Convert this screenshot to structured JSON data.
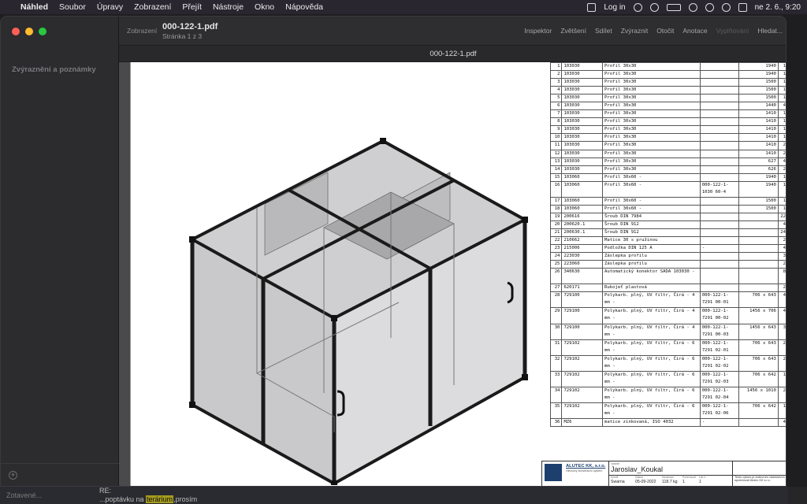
{
  "menubar": {
    "apple_glyph": "",
    "items": [
      "Náhled",
      "Soubor",
      "Úpravy",
      "Zobrazení",
      "Přejít",
      "Nástroje",
      "Okno",
      "Nápověda"
    ],
    "login": "Log in",
    "datetime": "ne 2. 6., 9:20"
  },
  "window": {
    "sidebar_title": "Zvýraznění a poznámky",
    "add_glyph": "+",
    "toolbar": {
      "view_label": "Zobrazení",
      "doc_name": "000-122-1.pdf",
      "page_info": "Stránka 1 z 3",
      "actions": [
        "Inspektor",
        "Zvětšení",
        "Sdílet",
        "Zvýraznit",
        "Otočit",
        "Anotace"
      ],
      "actions_disabled": [
        "Vyplňování"
      ],
      "search_label": "Hledat..."
    },
    "tab_title": "000-122-1.pdf"
  },
  "parts": [
    {
      "n": "1",
      "code": "103030",
      "desc": "Profil 30x30",
      "spec": "",
      "size": "1940",
      "qty": "1"
    },
    {
      "n": "2",
      "code": "103030",
      "desc": "Profil 30x30",
      "spec": "",
      "size": "1940",
      "qty": "1"
    },
    {
      "n": "3",
      "code": "103030",
      "desc": "Profil 30x30",
      "spec": "",
      "size": "1500",
      "qty": "1"
    },
    {
      "n": "4",
      "code": "103030",
      "desc": "Profil 30x30",
      "spec": "",
      "size": "1500",
      "qty": "1"
    },
    {
      "n": "5",
      "code": "103030",
      "desc": "Profil 30x30",
      "spec": "",
      "size": "1500",
      "qty": "1"
    },
    {
      "n": "6",
      "code": "103030",
      "desc": "Profil 30x30",
      "spec": "",
      "size": "1440",
      "qty": "4"
    },
    {
      "n": "7",
      "code": "103030",
      "desc": "Profil 30x30",
      "spec": "",
      "size": "1410",
      "qty": "1"
    },
    {
      "n": "8",
      "code": "103030",
      "desc": "Profil 30x30",
      "spec": "",
      "size": "1410",
      "qty": "1"
    },
    {
      "n": "9",
      "code": "103030",
      "desc": "Profil 30x30",
      "spec": "",
      "size": "1410",
      "qty": "1"
    },
    {
      "n": "10",
      "code": "103030",
      "desc": "Profil 30x30",
      "spec": "",
      "size": "1410",
      "qty": "1"
    },
    {
      "n": "11",
      "code": "103030",
      "desc": "Profil 30x30",
      "spec": "",
      "size": "1410",
      "qty": "2"
    },
    {
      "n": "12",
      "code": "103030",
      "desc": "Profil 30x30",
      "spec": "",
      "size": "1410",
      "qty": "2"
    },
    {
      "n": "13",
      "code": "103030",
      "desc": "Profil 30x30",
      "spec": "",
      "size": "627",
      "qty": "4"
    },
    {
      "n": "14",
      "code": "103030",
      "desc": "Profil 30x30",
      "spec": "",
      "size": "626",
      "qty": "2"
    },
    {
      "n": "15",
      "code": "103060",
      "desc": "Profil 30x60 -",
      "spec": "",
      "size": "1940",
      "qty": "1"
    },
    {
      "n": "16",
      "code": "103060",
      "desc": "Profil 30x60 -",
      "spec": "000-122-1-1030 60-4",
      "size": "1940",
      "qty": "1",
      "tall": true
    },
    {
      "n": "17",
      "code": "103060",
      "desc": "Profil 30x60 -",
      "spec": "",
      "size": "1500",
      "qty": "1"
    },
    {
      "n": "18",
      "code": "103060",
      "desc": "Profil 30x60 -",
      "spec": "",
      "size": "1500",
      "qty": "1"
    },
    {
      "n": "19",
      "code": "200616",
      "desc": "Šroub DIN 7984",
      "spec": "",
      "size": "",
      "qty": "22"
    },
    {
      "n": "20",
      "code": "200620.1",
      "desc": "Šroub DIN 912",
      "spec": "",
      "size": "",
      "qty": "4"
    },
    {
      "n": "21",
      "code": "200630.1",
      "desc": "Šroub DIN 912",
      "spec": "",
      "size": "",
      "qty": "24"
    },
    {
      "n": "22",
      "code": "210662",
      "desc": "Matice 30 s pružinou",
      "spec": "",
      "size": "",
      "qty": "2"
    },
    {
      "n": "23",
      "code": "215006",
      "desc": "Podložka DIN 125 A",
      "spec": "-",
      "size": "",
      "qty": "4"
    },
    {
      "n": "24",
      "code": "223030",
      "desc": "Záslepka profilu",
      "spec": "",
      "size": "",
      "qty": "3"
    },
    {
      "n": "25",
      "code": "223060",
      "desc": "Záslepka profilu",
      "spec": "",
      "size": "",
      "qty": "2"
    },
    {
      "n": "26",
      "code": "340630",
      "desc": "Automatický konektor SADA 103030 -",
      "spec": "",
      "size": "",
      "qty": "8",
      "tall": true
    },
    {
      "n": "27",
      "code": "620171",
      "desc": "Rukojeť plastová",
      "spec": "",
      "size": "",
      "qty": "2"
    },
    {
      "n": "28",
      "code": "729100",
      "desc": "Polykarb. plný, UV filtr, Čirá - 4 mm -",
      "spec": "000-122-1-7291 00-01",
      "size": "706 x 643",
      "qty": "4",
      "tall": true
    },
    {
      "n": "29",
      "code": "729100",
      "desc": "Polykarb. plný, UV filtr, Čirá - 4 mm -",
      "spec": "000-122-1-7291 00-02",
      "size": "1456 x 706",
      "qty": "4",
      "tall": true
    },
    {
      "n": "30",
      "code": "729100",
      "desc": "Polykarb. plný, UV filtr, Čirá - 4 mm -",
      "spec": "000-122-1-7291 00-03",
      "size": "1456 x 643",
      "qty": "3",
      "tall": true
    },
    {
      "n": "31",
      "code": "729102",
      "desc": "Polykarb. plný, UV filtr, Čirá - 6 mm -",
      "spec": "000-122-1-7291 02-01",
      "size": "706 x 643",
      "qty": "2",
      "tall": true
    },
    {
      "n": "32",
      "code": "729102",
      "desc": "Polykarb. plný, UV filtr, Čirá - 6 mm -",
      "spec": "000-122-1-7291 02-02",
      "size": "706 x 643",
      "qty": "2",
      "tall": true
    },
    {
      "n": "33",
      "code": "729102",
      "desc": "Polykarb. plný, UV filtr, Čirá - 6 mm -",
      "spec": "000-122-1-7291 02-03",
      "size": "706 x 642",
      "qty": "1",
      "tall": true
    },
    {
      "n": "34",
      "code": "729102",
      "desc": "Polykarb. plný, UV filtr, Čirá - 6 mm -",
      "spec": "000-122-1-7291 02-04",
      "size": "1456 x 1010",
      "qty": "2",
      "tall": true
    },
    {
      "n": "35",
      "code": "729102",
      "desc": "Polykarb. plný, UV filtr, Čirá - 6 mm -",
      "spec": "000-122-1-7291 02-06",
      "size": "706 x 642",
      "qty": "1",
      "tall": true
    },
    {
      "n": "36",
      "code": "MZ6",
      "desc": "matice zinkovaná, ISO 4032",
      "spec": "-",
      "size": "",
      "qty": "4"
    }
  ],
  "titleblock": {
    "company": "ALUTEC KK, s.r.o.",
    "company_sub": "Hliníkový konstrukční systém",
    "author_label": "Vytvořil",
    "author": "Jaroslav_Koukal",
    "checked_label": "Kreslil",
    "checked": "Swarna",
    "date_label": "Datum",
    "date": "05-09-2022",
    "mass_label": "Hmotnost",
    "mass": "118.7 kg",
    "ks_label": "Počet kusů",
    "ks": "1",
    "sheet_label": "List č.",
    "sheet": "1",
    "note": "Tento výkres je duševním vlastnictvím společnosti Alutec KK s.r.o."
  },
  "desktop": {
    "left_label": "Zotavené...",
    "re_label": "RE:",
    "snippet_before": "...poptávku na ",
    "snippet_highlight": "terárium",
    "snippet_after": ",prosím"
  },
  "colors": {
    "menubar_bg": "#2a2630",
    "traffic_close": "#ff5f57",
    "traffic_min": "#febc2e",
    "traffic_max": "#28c840",
    "viewer_bg": "#4a4a4c"
  }
}
